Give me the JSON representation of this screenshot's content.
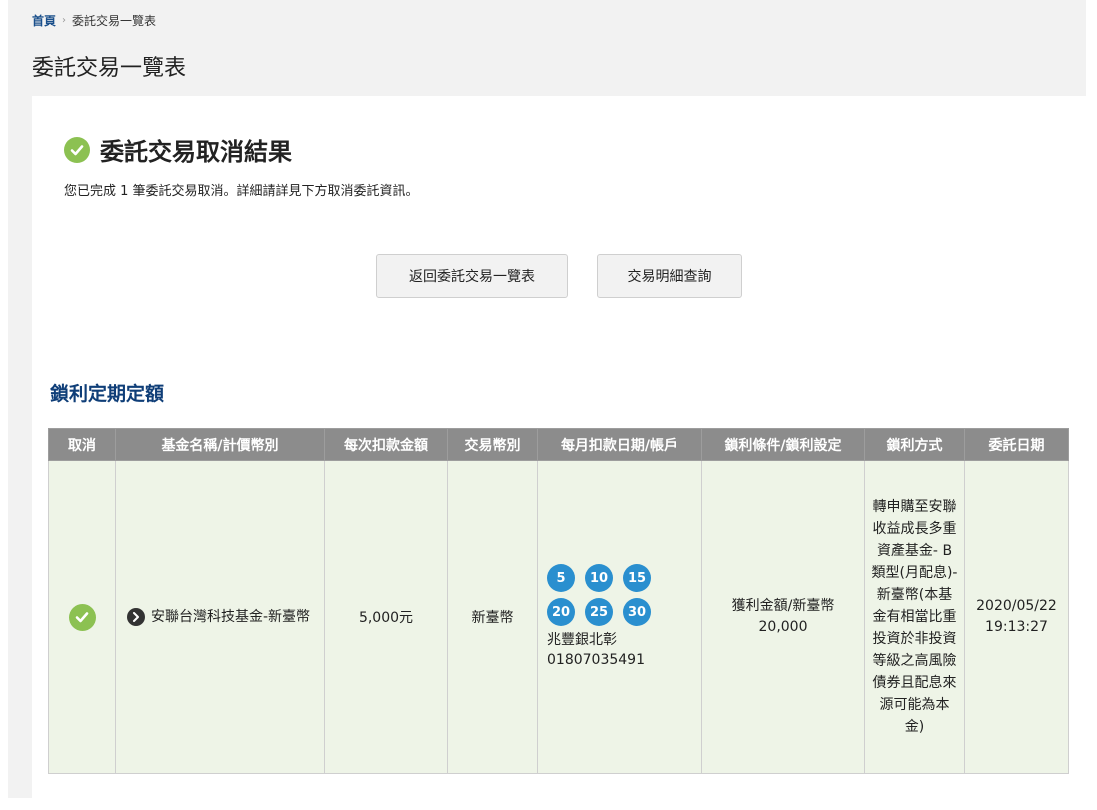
{
  "breadcrumb": {
    "home": "首頁",
    "current": "委託交易一覽表"
  },
  "page_title": "委託交易一覽表",
  "result": {
    "title": "委託交易取消結果",
    "message": "您已完成 1 筆委託交易取消。詳細請詳見下方取消委託資訊。"
  },
  "buttons": {
    "back": "返回委託交易一覽表",
    "detail": "交易明細查詢"
  },
  "section_title": "鎖利定期定額",
  "table": {
    "headers": [
      "取消",
      "基金名稱/計價幣別",
      "每次扣款金額",
      "交易幣別",
      "每月扣款日期/帳戶",
      "鎖利條件/鎖利設定",
      "鎖利方式",
      "委託日期"
    ],
    "row": {
      "fund": "安聯台灣科技基金-新臺幣",
      "amount": "5,000元",
      "currency": "新臺幣",
      "days": [
        "5",
        "10",
        "15",
        "20",
        "25",
        "30"
      ],
      "bank": "兆豐銀北彰",
      "account": "01807035491",
      "condition": "獲利金額/新臺幣 20,000",
      "method": "轉申購至安聯收益成長多重資產基金- B類型(月配息)-新臺幣(本基金有相當比重投資於非投資等級之高風險債券且配息來源可能為本金)",
      "date": "2020/05/22",
      "time": "19:13:27"
    }
  },
  "colors": {
    "accent": "#0f3e78",
    "success": "#8cc152",
    "day_badge": "#2a8fcf",
    "row_bg": "#eef4e7",
    "header_bg": "#8c8c8c"
  }
}
